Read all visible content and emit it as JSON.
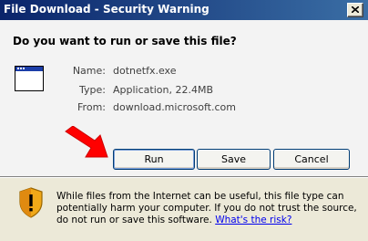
{
  "window": {
    "title": "File Download - Security Warning",
    "close_icon": "close-icon"
  },
  "dialog": {
    "question": "Do you want to run or save this file?",
    "file_icon": "application-window-icon",
    "fields": [
      {
        "label": "Name:",
        "value": "dotnetfx.exe"
      },
      {
        "label": "Type:",
        "value": "Application, 22.4MB"
      },
      {
        "label": "From:",
        "value": "download.microsoft.com"
      }
    ],
    "annotation_icon": "red-arrow-icon",
    "buttons": {
      "run": "Run",
      "save": "Save",
      "cancel": "Cancel"
    }
  },
  "warning": {
    "icon": "shield-warning-icon",
    "text": "While files from the Internet can be useful, this file type can potentially harm your computer. If you do not trust the source, do not run or save this software.",
    "link": "What's the risk?"
  },
  "colors": {
    "titlebar": "#0a246a",
    "arrow": "#ff0000",
    "shield": "#f0a818"
  }
}
